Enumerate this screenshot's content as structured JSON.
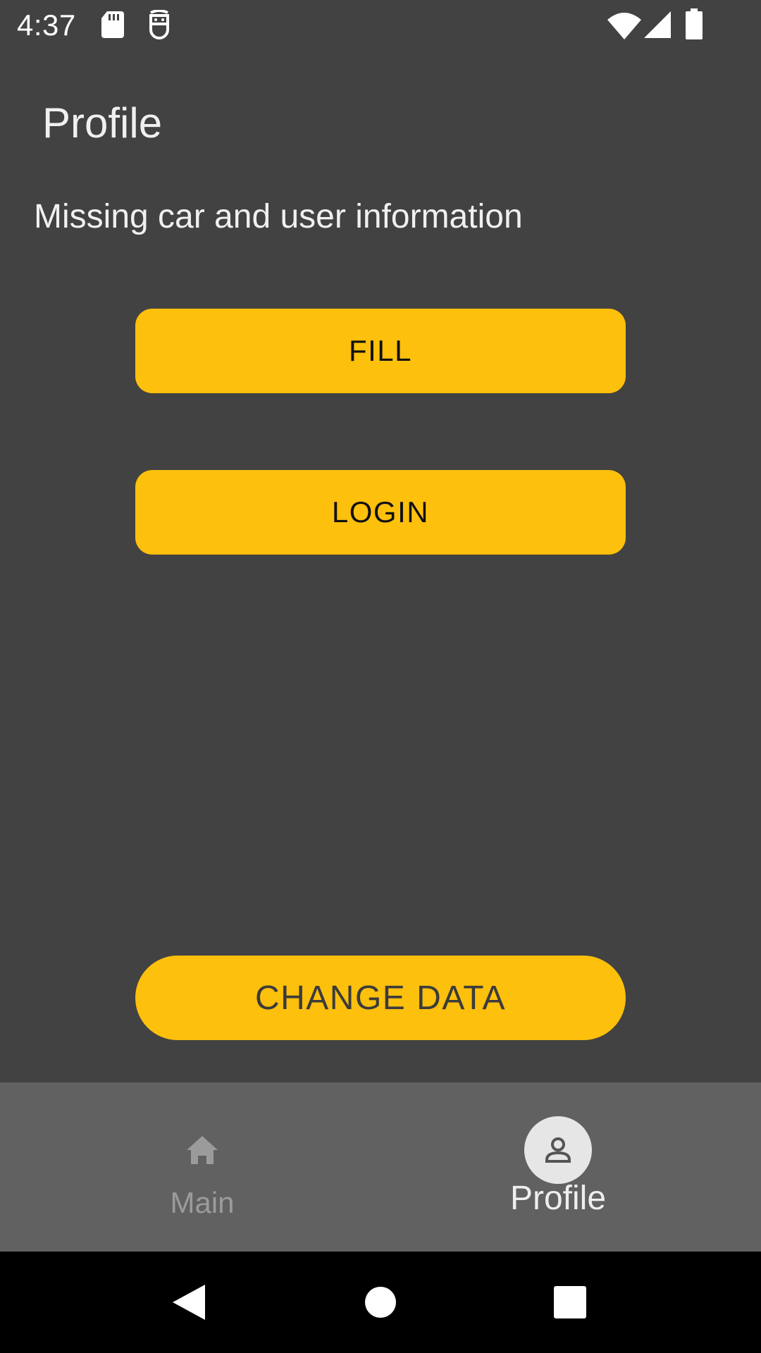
{
  "status_bar": {
    "time": "4:37",
    "icons": [
      "sd-card-icon",
      "debug-icon",
      "wifi-icon",
      "cell-signal-icon",
      "battery-icon"
    ]
  },
  "header": {
    "title": "Profile"
  },
  "main": {
    "info_text": "Missing car and user information",
    "fill_label": "FILL",
    "login_label": "LOGIN",
    "change_data_label": "CHANGE DATA"
  },
  "bottom_nav": {
    "items": [
      {
        "label": "Main",
        "icon": "home-icon",
        "selected": false
      },
      {
        "label": "Profile",
        "icon": "person-icon",
        "selected": true
      }
    ]
  },
  "system_nav": {
    "buttons": [
      "back-icon",
      "home-circle-icon",
      "recents-icon"
    ]
  },
  "colors": {
    "background": "#424242",
    "accent": "#fdc00c",
    "bottom_nav": "#616161",
    "system_nav": "#000000"
  }
}
